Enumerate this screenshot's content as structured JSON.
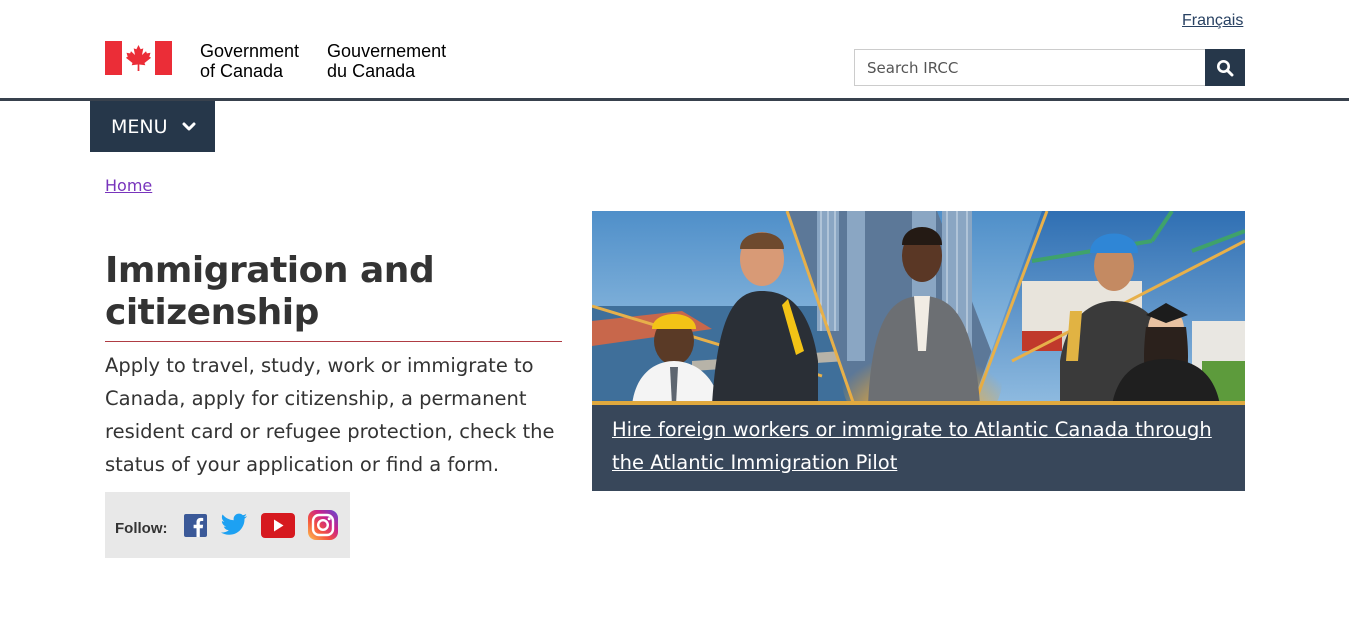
{
  "header": {
    "language_toggle": "Français",
    "brand_en_line1": "Government",
    "brand_en_line2": "of Canada",
    "brand_fr_line1": "Gouvernement",
    "brand_fr_line2": "du Canada",
    "search_placeholder": "Search IRCC",
    "menu_label": "MENU"
  },
  "breadcrumb": {
    "items": [
      {
        "label": "Home"
      }
    ]
  },
  "main": {
    "title": "Immigration and citizenship",
    "lead": "Apply to travel, study, work or immigrate to Canada, apply for citizenship, a permanent resident card or refugee protection, check the status of your application or find a form.",
    "follow_label": "Follow:",
    "social_icons": [
      "facebook-icon",
      "twitter-icon",
      "youtube-icon",
      "instagram-icon"
    ]
  },
  "feature": {
    "link_text": "Hire foreign workers or immigrate to Atlantic Canada through the Atlantic Immigration Pilot"
  },
  "colors": {
    "flag_red": "#eb2d37",
    "nav_blue": "#26374a",
    "link_visited": "#7834bc",
    "title_rule": "#af3c43",
    "caption_bg": "#38475a",
    "follow_bg": "#e8e8e8"
  }
}
